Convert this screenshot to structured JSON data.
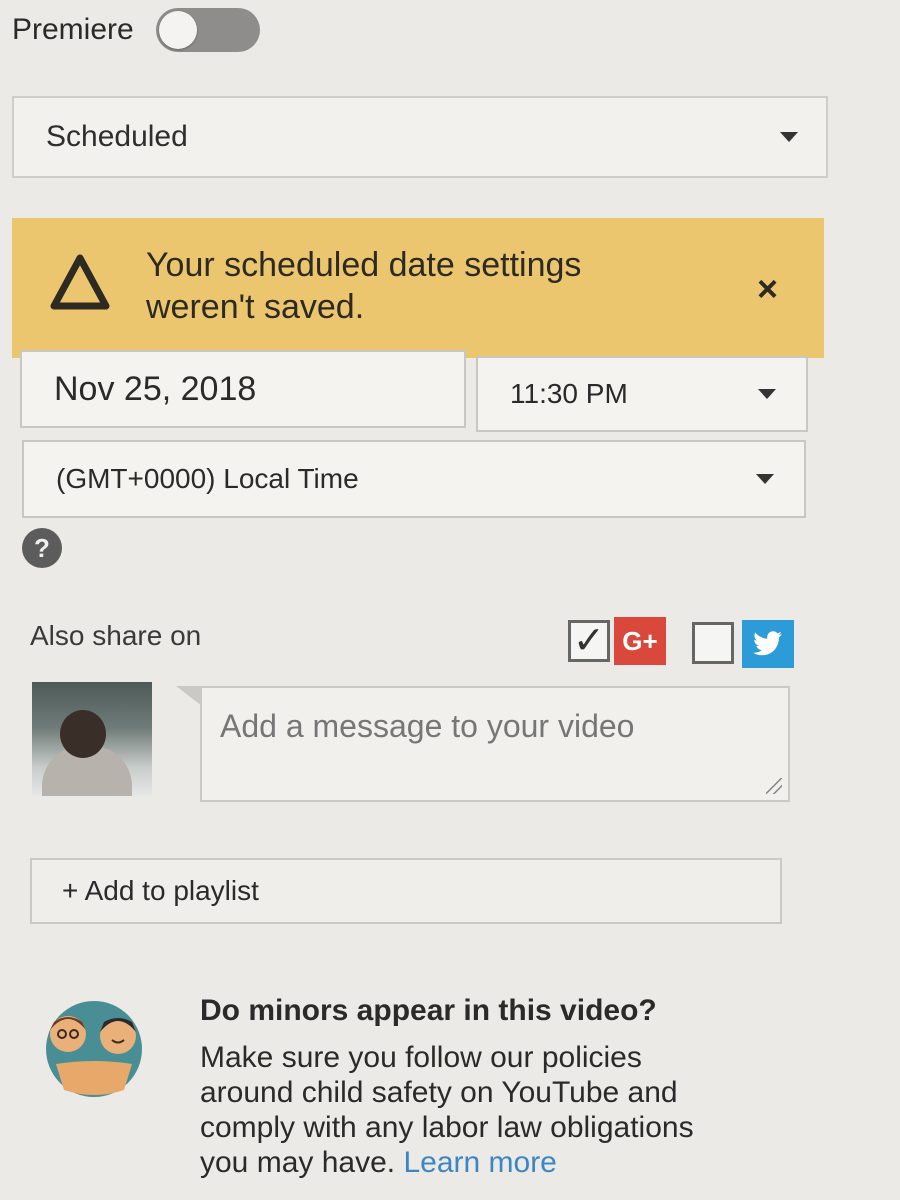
{
  "premiere": {
    "label": "Premiere",
    "enabled": false
  },
  "visibility_select": {
    "selected": "Scheduled"
  },
  "warning": {
    "line1": "Your scheduled date settings",
    "line2": "weren't saved.",
    "close_glyph": "×",
    "color": "#ecc66e"
  },
  "schedule": {
    "date": "Nov 25, 2018",
    "time": "11:30 PM",
    "timezone": "(GMT+0000) Local Time"
  },
  "help": {
    "glyph": "?"
  },
  "share": {
    "label": "Also share on",
    "google_plus": {
      "checked": true,
      "glyph": "G+",
      "color": "#d9483b"
    },
    "twitter": {
      "checked": false,
      "glyph": "🐦",
      "color": "#2d9bd8"
    }
  },
  "message": {
    "placeholder": "Add a message to your video"
  },
  "playlist": {
    "label": "+ Add to playlist"
  },
  "minors": {
    "title": "Do minors appear in this video?",
    "line1": "Make sure you follow our policies",
    "line2": "around child safety on YouTube and",
    "line3": "comply with any labor law obligations",
    "line4": "you may have.",
    "learn_more": "Learn more"
  }
}
